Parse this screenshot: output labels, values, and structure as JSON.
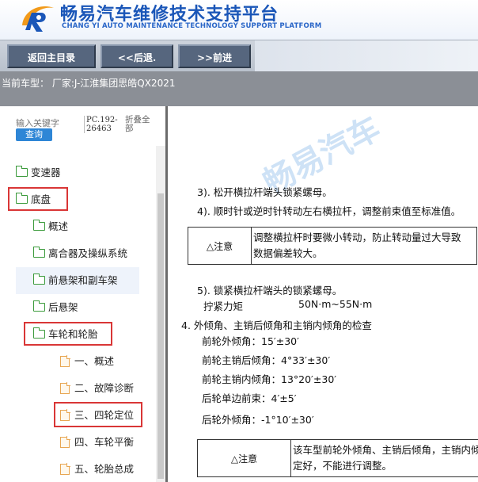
{
  "header": {
    "title_cn": "畅易汽车维修技术支持平台",
    "title_en": "CHANG YI AUTO MAINTENANCE TECHNOLOGY SUPPORT PLATFORM"
  },
  "toolbar": {
    "back_main": "返回主目录",
    "back": "<<后退.",
    "forward": ">>前进"
  },
  "car": {
    "current": "当前车型：  厂家:J-江淮集团思皓QX2021"
  },
  "sidebar": {
    "search_placeholder": "输入关键字",
    "search_button": "查询",
    "pc_code": "PC.192-26463",
    "collapse_all": "折叠全部",
    "items": [
      {
        "label": "变速器"
      },
      {
        "label": "底盘"
      },
      {
        "label": "概述"
      },
      {
        "label": "离合器及操纵系统"
      },
      {
        "label": "前悬架和副车架"
      },
      {
        "label": "后悬架"
      },
      {
        "label": "车轮和轮胎"
      },
      {
        "label": "一、概述"
      },
      {
        "label": "二、故障诊断"
      },
      {
        "label": "三、四轮定位"
      },
      {
        "label": "四、车轮平衡"
      },
      {
        "label": "五、轮胎总成"
      }
    ]
  },
  "content": {
    "watermark": "畅易汽车",
    "step3": "3).   松开横拉杆端头锁紧螺母。",
    "step4": "4).   顺时针或逆时针转动左右横拉杆，调整前束值至标准值。",
    "note1_head": "△注意",
    "note1_line1": "调整横拉杆时要微小转动，防止转动量过大导致",
    "note1_line2": "数据偏差较大。",
    "step5": "5).   锁紧横拉杆端头的锁紧螺母。",
    "torque_label": "拧紧力矩",
    "torque_value": "50N·m~55N·m",
    "section4": "4.   外倾角、主销后倾角和主销内倾角的检查",
    "spec1": "前轮外倾角：15′±30′",
    "spec2": "前轮主销后倾角：4°33′±30′",
    "spec3": "前轮主销内倾角：13°20′±30′",
    "spec4": "后轮单边前束：4′±5′",
    "spec5": "后轮外倾角：-1°10′±30′",
    "note2_head": "△注意",
    "note2_line1": "该车型前轮外倾角、主销后倾角，主销内倾",
    "note2_line2": "定好，不能进行调整。"
  },
  "colors": {
    "brand_blue": "#1a56b8",
    "toolbar_button": "#56667e",
    "highlight_red": "#d93636",
    "folder_green": "#3a9a3a",
    "doc_orange": "#e8a652"
  }
}
